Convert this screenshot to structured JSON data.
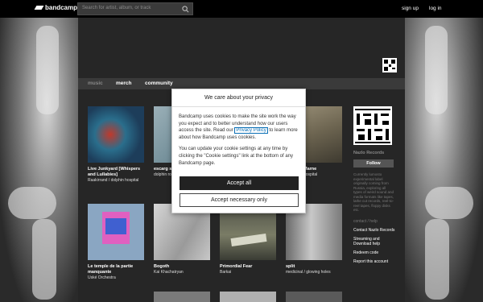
{
  "topbar": {
    "logo_text": "bandcamp",
    "search_placeholder": "Search for artist, album, or track",
    "signup": "sign up",
    "login": "log in"
  },
  "nav": {
    "music": "music",
    "merch": "merch",
    "community": "community"
  },
  "items": [
    {
      "title": "Live Junkyard [Whispers and Lullabies]",
      "artist": "Raakirrand / dolphin hospital",
      "color": "#2a6e8c"
    },
    {
      "title": "escarg sobrec",
      "artist": "dolphin rosario",
      "color": "#8aa0a8"
    },
    {
      "title": "Marne",
      "artist": "hospital",
      "color": "#8a8270"
    },
    {
      "title": "Le temple de la partie manquante",
      "artist": "Uské Orchestra",
      "color": "#8aa6c2"
    },
    {
      "title": "Bogoth",
      "artist": "Kai Khachatryan",
      "color": "#b4b4b4"
    },
    {
      "title": "Primordial Fear",
      "artist": "Barkai",
      "color": "#6e7060"
    },
    {
      "title": "split",
      "artist": "medicinal / glowing holes",
      "color": "#9a9a9a"
    }
  ],
  "sidebar": {
    "label_name": "Nazlo Records",
    "follow": "Follow",
    "description": "Currently lumosto experimental label originally coming from Russia, exploring all types of weird sound and media formats like tapes, lathe cut records, reel-to-reel tapes, floppy disks etc.",
    "contact_help": "contact / help",
    "links": [
      "Contact Nazlo Records",
      "Streaming and Download help",
      "Redeem code",
      "Report this account"
    ]
  },
  "cookie_modal": {
    "title": "We care about your privacy",
    "p1_before": "Bandcamp uses cookies to make the site work the way you expect and to better understand how our users access the site. Read our",
    "privacy_link": "Privacy Policy",
    "p1_after": "to learn more about how Bandcamp uses cookies.",
    "p2": "You can update your cookie settings at any time by clicking the \"Cookie settings\" link at the bottom of any Bandcamp page.",
    "accept_all": "Accept all",
    "accept_necessary": "Accept necessary only"
  }
}
